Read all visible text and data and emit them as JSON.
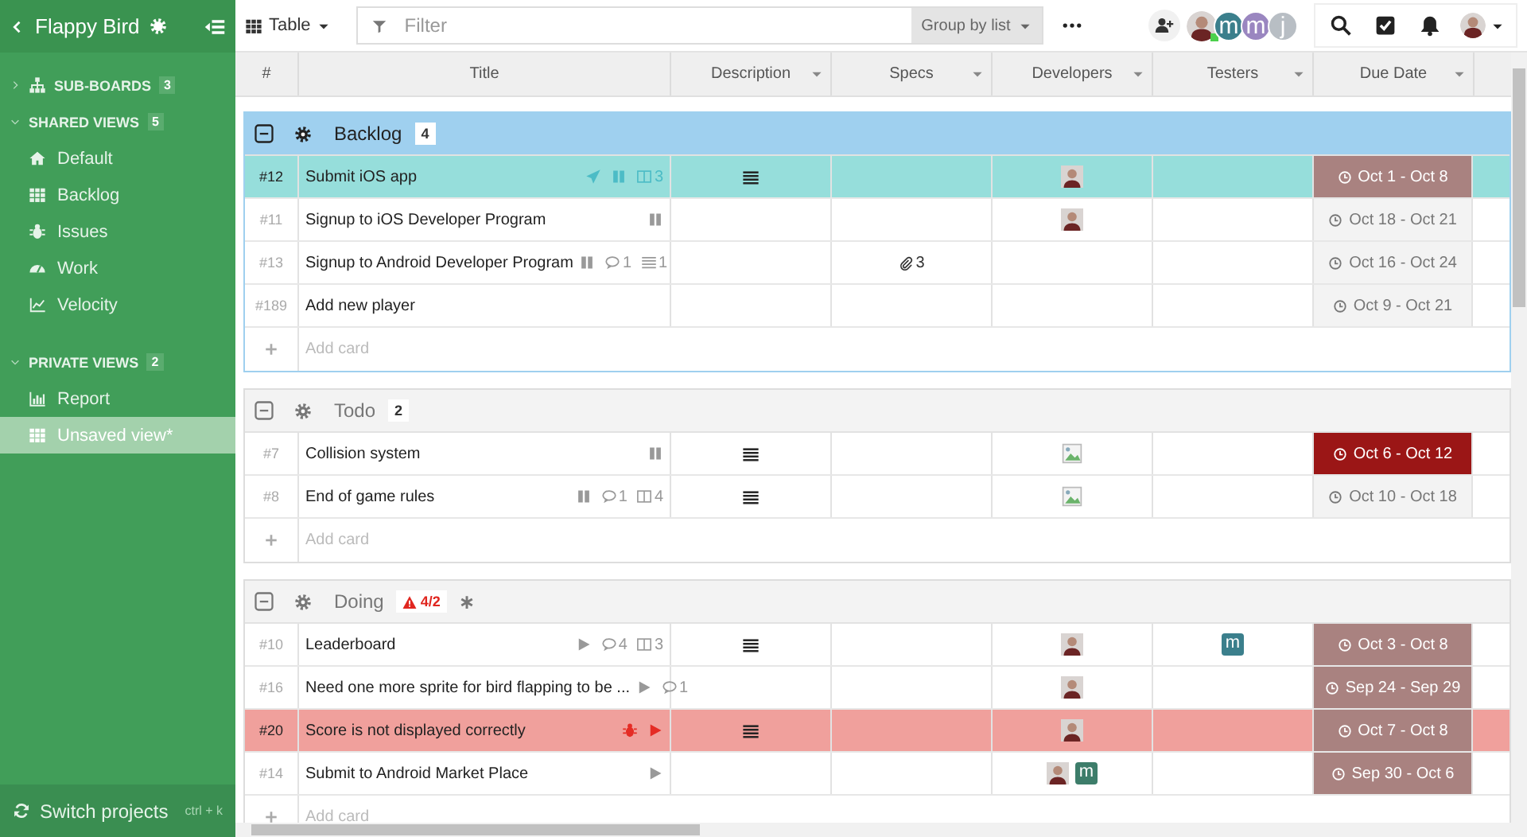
{
  "sidebar": {
    "title": "Flappy Bird",
    "sections": [
      {
        "label": "SUB-BOARDS",
        "count": "3",
        "expanded": false
      },
      {
        "label": "SHARED VIEWS",
        "count": "5",
        "expanded": true,
        "items": [
          {
            "label": "Default",
            "selected": false
          },
          {
            "label": "Backlog",
            "selected": false
          },
          {
            "label": "Issues",
            "selected": false
          },
          {
            "label": "Work",
            "selected": false
          },
          {
            "label": "Velocity",
            "selected": false
          }
        ]
      },
      {
        "label": "PRIVATE VIEWS",
        "count": "2",
        "expanded": true,
        "items": [
          {
            "label": "Report",
            "selected": false
          },
          {
            "label": "Unsaved view*",
            "selected": true
          }
        ]
      }
    ],
    "footer": {
      "label": "Switch projects",
      "shortcut": "ctrl + k"
    }
  },
  "toolbar": {
    "view": "Table",
    "filter": {
      "placeholder": "Filter"
    },
    "group_by": "Group by list",
    "members": [
      {
        "kind": "photo",
        "online": true
      },
      {
        "kind": "letter",
        "letter": "m",
        "color": "#3b7f8c",
        "online": false
      },
      {
        "kind": "letter",
        "letter": "m",
        "color": "#9a86c0",
        "online": false
      },
      {
        "kind": "letter",
        "letter": "j",
        "color": "#b8bec4",
        "online": false
      }
    ]
  },
  "table": {
    "columns": [
      {
        "label": "#",
        "menu": false
      },
      {
        "label": "Title",
        "menu": false
      },
      {
        "label": "Description",
        "menu": true
      },
      {
        "label": "Specs",
        "menu": true
      },
      {
        "label": "Developers",
        "menu": true
      },
      {
        "label": "Testers",
        "menu": true
      },
      {
        "label": "Due Date",
        "menu": true
      }
    ],
    "groups": [
      {
        "name": "Backlog",
        "count": "4",
        "selected": true,
        "marked": false,
        "add_label": "Add card",
        "rows": [
          {
            "id": "#12",
            "title": "Submit iOS app",
            "kind": "selected",
            "badges": [
              {
                "kind": "plane"
              },
              {
                "kind": "pause"
              },
              {
                "kind": "board",
                "count": "3"
              }
            ],
            "description": true,
            "developers": [
              {
                "kind": "photo"
              }
            ],
            "due": {
              "text": "Oct 1 - Oct 8",
              "color": "#a98280"
            }
          },
          {
            "id": "#11",
            "title": "Signup to iOS Developer Program",
            "kind": "normal",
            "badges": [
              {
                "kind": "pause"
              }
            ],
            "description": false,
            "developers": [
              {
                "kind": "photo"
              }
            ],
            "due": {
              "text": "Oct 18 - Oct 21",
              "color": "#f3f3f3"
            }
          },
          {
            "id": "#13",
            "title": "Signup to Android Developer Program",
            "kind": "normal",
            "badges": [
              {
                "kind": "pause"
              },
              {
                "kind": "comment",
                "count": "1"
              },
              {
                "kind": "list",
                "count": "1"
              }
            ],
            "description": false,
            "specs": "3",
            "due": {
              "text": "Oct 16 - Oct 24",
              "color": "#f3f3f3"
            }
          },
          {
            "id": "#189",
            "title": "Add new player",
            "kind": "normal",
            "description": false,
            "due": {
              "text": "Oct 9 - Oct 21",
              "color": "#f3f3f3"
            }
          }
        ]
      },
      {
        "name": "Todo",
        "count": "2",
        "selected": false,
        "marked": false,
        "add_label": "Add card",
        "rows": [
          {
            "id": "#7",
            "title": "Collision system",
            "kind": "normal",
            "badges": [
              {
                "kind": "pause"
              }
            ],
            "description": true,
            "developers": [
              {
                "kind": "broken"
              }
            ],
            "due": {
              "text": "Oct 6 - Oct 12",
              "color": "#9b1616"
            }
          },
          {
            "id": "#8",
            "title": "End of game rules",
            "kind": "normal",
            "badges": [
              {
                "kind": "pause"
              },
              {
                "kind": "comment",
                "count": "1"
              },
              {
                "kind": "board",
                "count": "4"
              }
            ],
            "description": true,
            "developers": [
              {
                "kind": "broken"
              }
            ],
            "due": {
              "text": "Oct 10 - Oct 18",
              "color": "#f3f3f3"
            }
          }
        ]
      },
      {
        "name": "Doing",
        "count": "4/2",
        "warning": true,
        "selected": false,
        "marked": true,
        "add_label": "Add card",
        "rows": [
          {
            "id": "#10",
            "title": "Leaderboard",
            "kind": "normal",
            "badges": [
              {
                "kind": "play"
              },
              {
                "kind": "comment",
                "count": "4"
              },
              {
                "kind": "board",
                "count": "3"
              }
            ],
            "description": true,
            "developers": [
              {
                "kind": "photo"
              }
            ],
            "testers": [
              {
                "kind": "letter",
                "letter": "m",
                "color": "#3b7f8c"
              }
            ],
            "due": {
              "text": "Oct 3 - Oct 8",
              "color": "#a98280"
            }
          },
          {
            "id": "#16",
            "title": "Need one more sprite for bird flapping to be ...",
            "kind": "normal",
            "badges": [
              {
                "kind": "play"
              },
              {
                "kind": "comment",
                "count": "1"
              }
            ],
            "description": false,
            "developers": [
              {
                "kind": "photo"
              }
            ],
            "due": {
              "text": "Sep 24 - Sep 29",
              "color": "#a98280"
            }
          },
          {
            "id": "#20",
            "title": "Score is not displayed correctly",
            "kind": "bug",
            "badges": [
              {
                "kind": "bug"
              },
              {
                "kind": "play"
              }
            ],
            "description": true,
            "developers": [
              {
                "kind": "photo"
              }
            ],
            "due": {
              "text": "Oct 7 - Oct 8",
              "color": "#a98280"
            }
          },
          {
            "id": "#14",
            "title": "Submit to Android Market Place",
            "kind": "normal",
            "badges": [
              {
                "kind": "play"
              }
            ],
            "description": false,
            "developers": [
              {
                "kind": "photo"
              },
              {
                "kind": "letter",
                "letter": "m",
                "color": "#3d7d6a"
              }
            ],
            "due": {
              "text": "Sep 30 - Oct 6",
              "color": "#a98280"
            }
          }
        ]
      }
    ]
  }
}
